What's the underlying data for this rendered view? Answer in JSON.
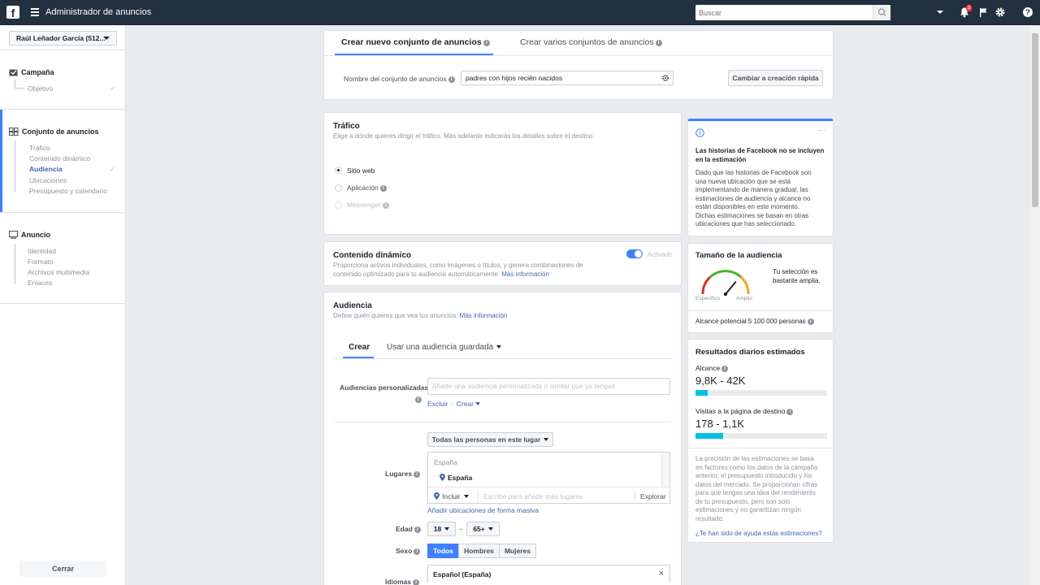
{
  "topbar": {
    "logo": "f",
    "app_title": "Administrador de anuncios",
    "search_placeholder": "Buscar",
    "notification_count": "2"
  },
  "sidebar": {
    "account": "Raúl Leñador García (512...",
    "sections": [
      {
        "title": "Campaña",
        "items": [
          "Objetivo"
        ]
      },
      {
        "title": "Conjunto de anuncios",
        "items": [
          "Tráfico",
          "Contenido dinámico",
          "Audiencia",
          "Ubicaciones",
          "Presupuesto y calendario"
        ]
      },
      {
        "title": "Anuncio",
        "items": [
          "Identidad",
          "Formato",
          "Archivos multimedia",
          "Enlaces"
        ]
      }
    ],
    "close": "Cerrar"
  },
  "header_card": {
    "tab_active": "Crear nuevo conjunto de anuncios",
    "tab_other": "Crear varios conjuntos de anuncios",
    "name_label": "Nombre del conjunto de anuncios",
    "name_value": "padres con hijos recién nacidos",
    "quick_button": "Cambiar a creación rápida"
  },
  "traffic": {
    "title": "Tráfico",
    "desc": "Elige a dónde quieres dirigir el tráfico. Más adelante indicarás los detalles sobre el destino.",
    "options": [
      "Sitio web",
      "Aplicación",
      "Messenger"
    ]
  },
  "dynamic": {
    "title": "Contenido dinámico",
    "desc1": "Proporciona activos individuales, como imágenes o títulos, y genera combinaciones de",
    "desc2": "contenido optimizado para tu audiencia automáticamente.",
    "link": "Más información",
    "toggle_label": "Activado"
  },
  "audience": {
    "title": "Audiencia",
    "desc": "Define quién quieres que vea tus anuncios.",
    "link": "Más información",
    "tab_create": "Crear",
    "tab_saved": "Usar una audiencia guardada",
    "custom_label": "Audiencias personalizadas",
    "custom_placeholder": "Añade una audiencia personalizada o similar que ya tengas",
    "exclude": "Excluir",
    "create": "Crear",
    "location_dropdown": "Todas las personas en este lugar",
    "locations_label": "Lugares",
    "country_header": "España",
    "country_selected": "España",
    "include": "Incluir",
    "location_placeholder": "Escribe para añadir más lugares",
    "explore": "Explorar",
    "bulk_link": "Añadir ubicaciones de forma masiva",
    "age_label": "Edad",
    "age_min": "18",
    "age_sep": "-",
    "age_max": "65+",
    "gender_label": "Sexo",
    "gender_options": [
      "Todos",
      "Hombres",
      "Mujeres"
    ],
    "language_label": "Idiomas",
    "language_value": "Español (España)"
  },
  "right_panel": {
    "notice_title1": "Las historias de Facebook no se incluyen",
    "notice_title2": "en la estimación",
    "notice_lines": [
      "Dado que las historias de Facebook son",
      "una nueva ubicación que se está",
      "implementando de manera gradual, las",
      "estimaciones de audiencia y alcance no",
      "están disponibles en este momento.",
      "Dichas estimaciones se basan en otras",
      "ubicaciones que has seleccionado."
    ],
    "size_title": "Tamaño de la audiencia",
    "gauge_left": "Específico",
    "gauge_right": "Amplio",
    "gauge_level": 0.72,
    "size_note1": "Tu selección es",
    "size_note2": "bastante amplia.",
    "reach_potential": "Alcance potencial:5 100 000 personas",
    "daily_title": "Resultados diarios estimados",
    "reach_label": "Alcance",
    "reach_value": "9,8K - 42K",
    "reach_fill": 0.09,
    "visits_label": "Visitas a la página de destino",
    "visits_value": "178 - 1,1K",
    "visits_fill": 0.21,
    "accuracy_lines": [
      "La precisión de las estimaciones se basa",
      "en factores como los datos de la campaña",
      "anterior, el presupuesto introducido y los",
      "datos del mercado. Se proporcionan cifras",
      "para que tengas una idea del rendimiento",
      "de tu presupuesto, pero son solo",
      "estimaciones y no garantizan ningún",
      "resultado."
    ],
    "helpful_link": "¿Te han sido de ayuda estas estimaciones?"
  }
}
